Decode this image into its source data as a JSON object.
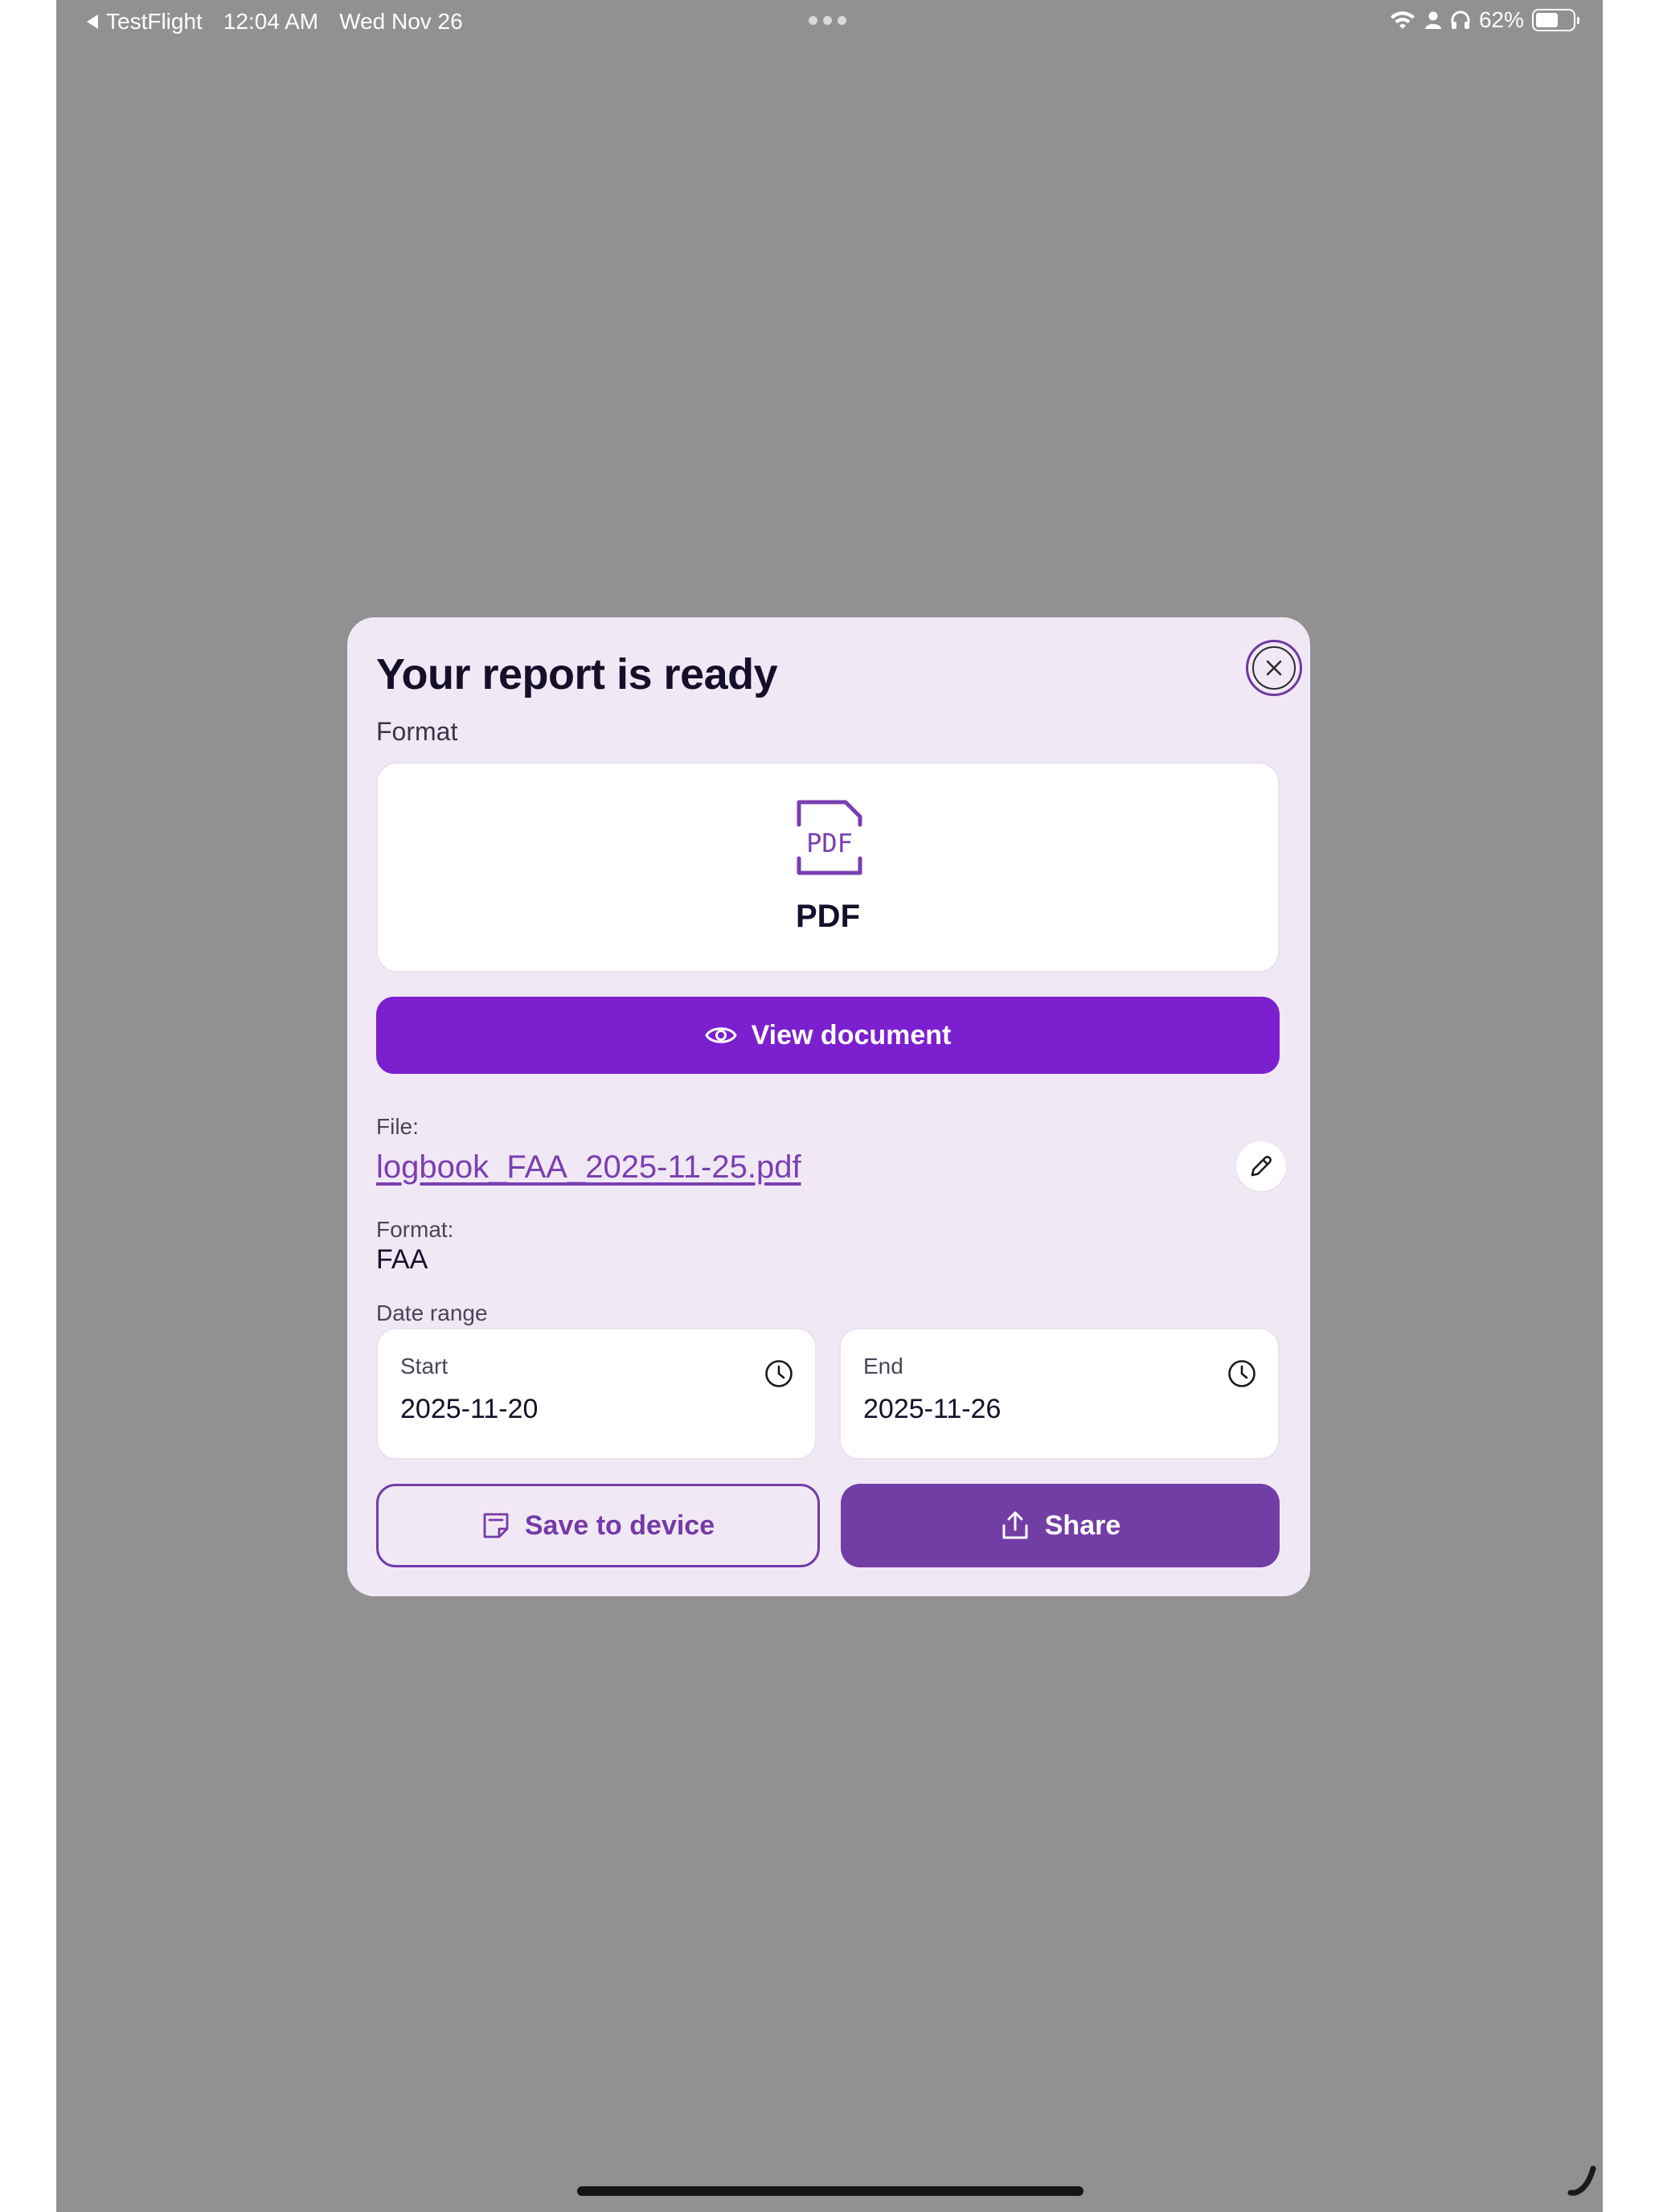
{
  "status_bar": {
    "back_app": "TestFlight",
    "time": "12:04 AM",
    "date": "Wed Nov 26",
    "battery_percent": "62%",
    "battery_level": 0.62,
    "icons": [
      "wifi-icon",
      "person-icon",
      "headphones-icon",
      "battery-icon"
    ]
  },
  "modal": {
    "title": "Your report is ready",
    "format_label": "Format",
    "format_card": {
      "icon_text": "PDF",
      "name": "PDF"
    },
    "view_button_label": "View document",
    "file_label": "File:",
    "file_name": "logbook_FAA_2025-11-25.pdf",
    "format_label_2": "Format:",
    "format_value": "FAA",
    "date_range_label": "Date range",
    "start": {
      "label": "Start",
      "value": "2025-11-20"
    },
    "end": {
      "label": "End",
      "value": "2025-11-26"
    },
    "save_button_label": "Save to device",
    "share_button_label": "Share"
  },
  "colors": {
    "backdrop": "#919191",
    "modal_bg": "#f1e8f5",
    "primary": "#7b1fcf",
    "secondary": "#733da6",
    "link": "#7a3fb0",
    "title": "#15102a"
  }
}
